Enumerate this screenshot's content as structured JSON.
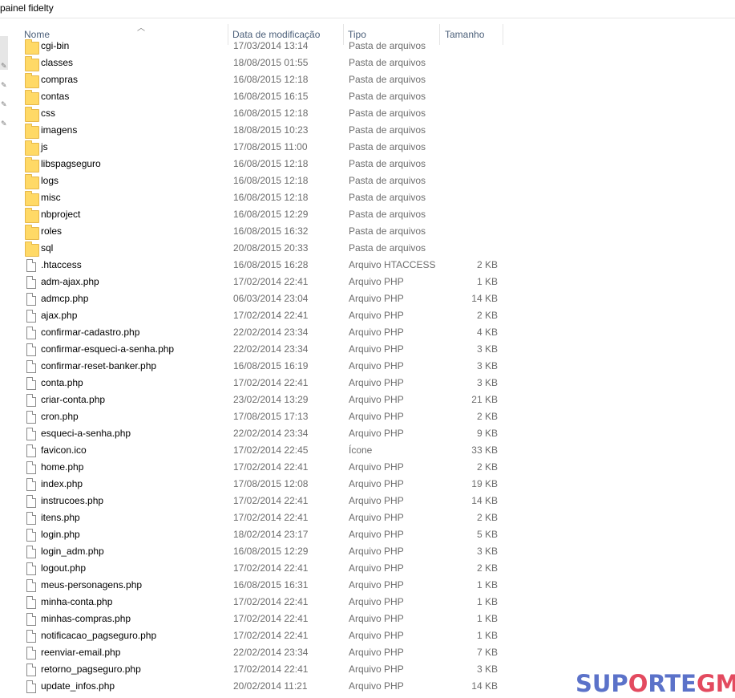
{
  "window": {
    "title": "painel fidelty"
  },
  "columns": {
    "name": "Nome",
    "date": "Data de modificação",
    "type": "Tipo",
    "size": "Tamanho"
  },
  "files": [
    {
      "name": "cgi-bin",
      "date": "17/03/2014 13:14",
      "type": "Pasta de arquivos",
      "size": "",
      "kind": "folder"
    },
    {
      "name": "classes",
      "date": "18/08/2015 01:55",
      "type": "Pasta de arquivos",
      "size": "",
      "kind": "folder"
    },
    {
      "name": "compras",
      "date": "16/08/2015 12:18",
      "type": "Pasta de arquivos",
      "size": "",
      "kind": "folder"
    },
    {
      "name": "contas",
      "date": "16/08/2015 16:15",
      "type": "Pasta de arquivos",
      "size": "",
      "kind": "folder"
    },
    {
      "name": "css",
      "date": "16/08/2015 12:18",
      "type": "Pasta de arquivos",
      "size": "",
      "kind": "folder"
    },
    {
      "name": "imagens",
      "date": "18/08/2015 10:23",
      "type": "Pasta de arquivos",
      "size": "",
      "kind": "folder"
    },
    {
      "name": "js",
      "date": "17/08/2015 11:00",
      "type": "Pasta de arquivos",
      "size": "",
      "kind": "folder"
    },
    {
      "name": "libspagseguro",
      "date": "16/08/2015 12:18",
      "type": "Pasta de arquivos",
      "size": "",
      "kind": "folder"
    },
    {
      "name": "logs",
      "date": "16/08/2015 12:18",
      "type": "Pasta de arquivos",
      "size": "",
      "kind": "folder"
    },
    {
      "name": "misc",
      "date": "16/08/2015 12:18",
      "type": "Pasta de arquivos",
      "size": "",
      "kind": "folder"
    },
    {
      "name": "nbproject",
      "date": "16/08/2015 12:29",
      "type": "Pasta de arquivos",
      "size": "",
      "kind": "folder"
    },
    {
      "name": "roles",
      "date": "16/08/2015 16:32",
      "type": "Pasta de arquivos",
      "size": "",
      "kind": "folder"
    },
    {
      "name": "sql",
      "date": "20/08/2015 20:33",
      "type": "Pasta de arquivos",
      "size": "",
      "kind": "folder"
    },
    {
      "name": ".htaccess",
      "date": "16/08/2015 16:28",
      "type": "Arquivo HTACCESS",
      "size": "2 KB",
      "kind": "file"
    },
    {
      "name": "adm-ajax.php",
      "date": "17/02/2014 22:41",
      "type": "Arquivo PHP",
      "size": "1 KB",
      "kind": "file"
    },
    {
      "name": "admcp.php",
      "date": "06/03/2014 23:04",
      "type": "Arquivo PHP",
      "size": "14 KB",
      "kind": "file"
    },
    {
      "name": "ajax.php",
      "date": "17/02/2014 22:41",
      "type": "Arquivo PHP",
      "size": "2 KB",
      "kind": "file"
    },
    {
      "name": "confirmar-cadastro.php",
      "date": "22/02/2014 23:34",
      "type": "Arquivo PHP",
      "size": "4 KB",
      "kind": "file"
    },
    {
      "name": "confirmar-esqueci-a-senha.php",
      "date": "22/02/2014 23:34",
      "type": "Arquivo PHP",
      "size": "3 KB",
      "kind": "file"
    },
    {
      "name": "confirmar-reset-banker.php",
      "date": "16/08/2015 16:19",
      "type": "Arquivo PHP",
      "size": "3 KB",
      "kind": "file"
    },
    {
      "name": "conta.php",
      "date": "17/02/2014 22:41",
      "type": "Arquivo PHP",
      "size": "3 KB",
      "kind": "file"
    },
    {
      "name": "criar-conta.php",
      "date": "23/02/2014 13:29",
      "type": "Arquivo PHP",
      "size": "21 KB",
      "kind": "file"
    },
    {
      "name": "cron.php",
      "date": "17/08/2015 17:13",
      "type": "Arquivo PHP",
      "size": "2 KB",
      "kind": "file"
    },
    {
      "name": "esqueci-a-senha.php",
      "date": "22/02/2014 23:34",
      "type": "Arquivo PHP",
      "size": "9 KB",
      "kind": "file"
    },
    {
      "name": "favicon.ico",
      "date": "17/02/2014 22:45",
      "type": "Ícone",
      "size": "33 KB",
      "kind": "file"
    },
    {
      "name": "home.php",
      "date": "17/02/2014 22:41",
      "type": "Arquivo PHP",
      "size": "2 KB",
      "kind": "file"
    },
    {
      "name": "index.php",
      "date": "17/08/2015 12:08",
      "type": "Arquivo PHP",
      "size": "19 KB",
      "kind": "file"
    },
    {
      "name": "instrucoes.php",
      "date": "17/02/2014 22:41",
      "type": "Arquivo PHP",
      "size": "14 KB",
      "kind": "file"
    },
    {
      "name": "itens.php",
      "date": "17/02/2014 22:41",
      "type": "Arquivo PHP",
      "size": "2 KB",
      "kind": "file"
    },
    {
      "name": "login.php",
      "date": "18/02/2014 23:17",
      "type": "Arquivo PHP",
      "size": "5 KB",
      "kind": "file"
    },
    {
      "name": "login_adm.php",
      "date": "16/08/2015 12:29",
      "type": "Arquivo PHP",
      "size": "3 KB",
      "kind": "file"
    },
    {
      "name": "logout.php",
      "date": "17/02/2014 22:41",
      "type": "Arquivo PHP",
      "size": "2 KB",
      "kind": "file"
    },
    {
      "name": "meus-personagens.php",
      "date": "16/08/2015 16:31",
      "type": "Arquivo PHP",
      "size": "1 KB",
      "kind": "file"
    },
    {
      "name": "minha-conta.php",
      "date": "17/02/2014 22:41",
      "type": "Arquivo PHP",
      "size": "1 KB",
      "kind": "file"
    },
    {
      "name": "minhas-compras.php",
      "date": "17/02/2014 22:41",
      "type": "Arquivo PHP",
      "size": "1 KB",
      "kind": "file"
    },
    {
      "name": "notificacao_pagseguro.php",
      "date": "17/02/2014 22:41",
      "type": "Arquivo PHP",
      "size": "1 KB",
      "kind": "file"
    },
    {
      "name": "reenviar-email.php",
      "date": "22/02/2014 23:34",
      "type": "Arquivo PHP",
      "size": "7 KB",
      "kind": "file"
    },
    {
      "name": "retorno_pagseguro.php",
      "date": "17/02/2014 22:41",
      "type": "Arquivo PHP",
      "size": "3 KB",
      "kind": "file"
    },
    {
      "name": "update_infos.php",
      "date": "20/02/2014 11:21",
      "type": "Arquivo PHP",
      "size": "14 KB",
      "kind": "file"
    }
  ],
  "watermark": {
    "part1": "SUP",
    "part2": "O",
    "part3": "RTE",
    "part4": "GM"
  }
}
